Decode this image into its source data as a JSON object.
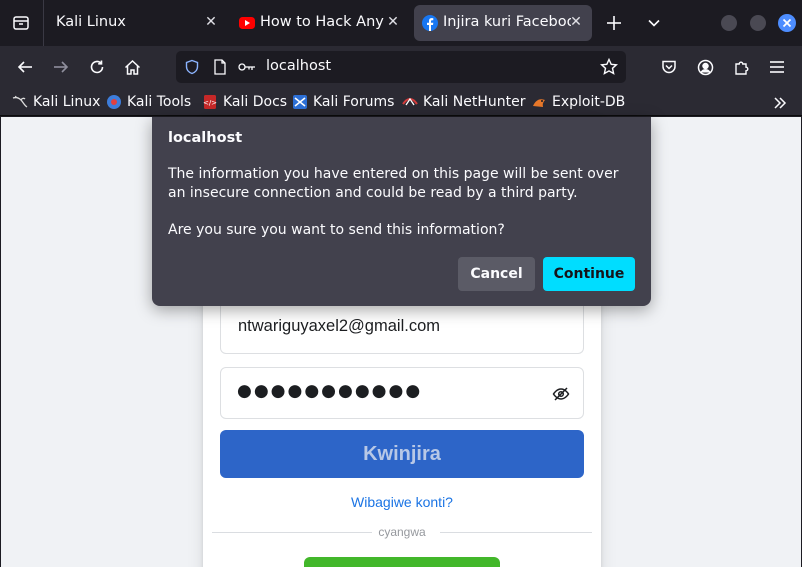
{
  "browser": {
    "tabs": [
      {
        "title": "Kali Linux",
        "active": false
      },
      {
        "title": "How to Hack Any Ac",
        "active": false
      },
      {
        "title": "Injira kuri Facebook",
        "active": true
      }
    ],
    "address": "localhost",
    "accent_color": "#00ddff",
    "bookmarks": [
      {
        "label": "Kali Linux",
        "icon": "kali-dragon-icon"
      },
      {
        "label": "Kali Tools",
        "icon": "kali-tools-icon"
      },
      {
        "label": "Kali Docs",
        "icon": "kali-docs-icon"
      },
      {
        "label": "Kali Forums",
        "icon": "kali-forums-icon"
      },
      {
        "label": "Kali NetHunter",
        "icon": "kali-nethunter-icon"
      },
      {
        "label": "Exploit-DB",
        "icon": "exploit-db-icon"
      }
    ]
  },
  "form": {
    "email_value": "ntwariguyaxel2@gmail.com",
    "password_masked": "●●●●●●●●●●●",
    "login_label": "Kwinjira",
    "forgot_label": "Wibagiwe konti?",
    "or_label": "cyangwa",
    "brand_color": "#1877f2",
    "create_color": "#42b72a"
  },
  "dialog": {
    "title": "localhost",
    "message": "The information you have entered on this page will be sent over an insecure connection and could be read by a third party.",
    "question": "Are you sure you want to send this information?",
    "cancel_label": "Cancel",
    "continue_label": "Continue"
  }
}
